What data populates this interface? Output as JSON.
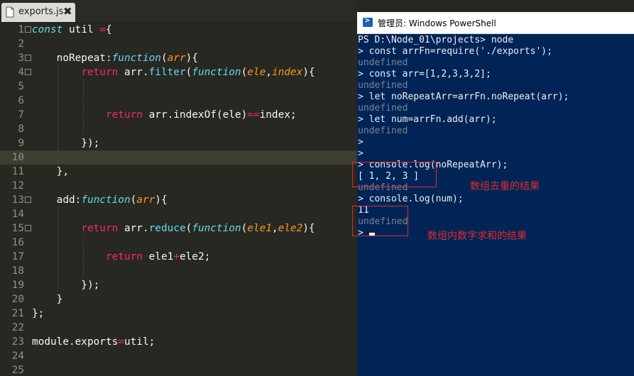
{
  "editor": {
    "tab": {
      "label": "exports.js",
      "close": "✖"
    },
    "lines": [
      {
        "n": "1",
        "fold": true,
        "html": "<span class=\"kw\">const</span> util <span class=\"op\">=</span>{"
      },
      {
        "n": "2",
        "fold": false,
        "html": ""
      },
      {
        "n": "3",
        "fold": true,
        "html": "    noRepeat:<span class=\"kw\">function</span>(<span class=\"arg\">arr</span>){"
      },
      {
        "n": "4",
        "fold": true,
        "html": "        <span class=\"ret\">return</span> arr.<span class=\"fn\">filter</span>(<span class=\"kw\">function</span>(<span class=\"arg\">ele</span>,<span class=\"arg\">index</span>){"
      },
      {
        "n": "5",
        "fold": false,
        "html": ""
      },
      {
        "n": "6",
        "fold": false,
        "html": ""
      },
      {
        "n": "7",
        "fold": false,
        "html": "            <span class=\"ret\">return</span> arr.indexOf(ele)<span class=\"op\">==</span>index;"
      },
      {
        "n": "8",
        "fold": false,
        "html": ""
      },
      {
        "n": "9",
        "fold": false,
        "html": "        });"
      },
      {
        "n": "10",
        "fold": false,
        "html": "",
        "current": true
      },
      {
        "n": "11",
        "fold": false,
        "html": "    },"
      },
      {
        "n": "12",
        "fold": false,
        "html": ""
      },
      {
        "n": "13",
        "fold": true,
        "html": "    add:<span class=\"kw\">function</span>(<span class=\"arg\">arr</span>){"
      },
      {
        "n": "14",
        "fold": false,
        "html": ""
      },
      {
        "n": "15",
        "fold": true,
        "html": "        <span class=\"ret\">return</span> arr.<span class=\"fn\">reduce</span>(<span class=\"kw\">function</span>(<span class=\"arg\">ele1</span>,<span class=\"arg\">ele2</span>){"
      },
      {
        "n": "16",
        "fold": false,
        "html": ""
      },
      {
        "n": "17",
        "fold": false,
        "html": "            <span class=\"ret\">return</span> ele1<span class=\"op\">+</span>ele2;"
      },
      {
        "n": "18",
        "fold": false,
        "html": ""
      },
      {
        "n": "19",
        "fold": false,
        "html": "        });"
      },
      {
        "n": "20",
        "fold": false,
        "html": "    }"
      },
      {
        "n": "21",
        "fold": false,
        "html": "};"
      },
      {
        "n": "22",
        "fold": false,
        "html": ""
      },
      {
        "n": "23",
        "fold": false,
        "html": "module.exports<span class=\"op\">=</span>util;"
      },
      {
        "n": "24",
        "fold": false,
        "html": ""
      },
      {
        "n": "25",
        "fold": false,
        "html": ""
      }
    ]
  },
  "powershell": {
    "title": "管理员: Windows PowerShell",
    "lines": [
      {
        "text": "PS D:\\Node_01\\projects> node",
        "dim": false
      },
      {
        "text": "> const arrFn=require('./exports');",
        "dim": false
      },
      {
        "text": "undefined",
        "dim": true
      },
      {
        "text": "> const arr=[1,2,3,3,2];",
        "dim": false
      },
      {
        "text": "undefined",
        "dim": true
      },
      {
        "text": "> let noRepeatArr=arrFn.noRepeat(arr);",
        "dim": false
      },
      {
        "text": "undefined",
        "dim": true
      },
      {
        "text": "> let num=arrFn.add(arr);",
        "dim": false
      },
      {
        "text": "undefined",
        "dim": true
      },
      {
        "text": ">",
        "dim": false
      },
      {
        "text": ">",
        "dim": false
      },
      {
        "text": "> console.log(noRepeatArr);",
        "dim": false
      },
      {
        "text": "[ 1, 2, 3 ]",
        "dim": false
      },
      {
        "text": "undefined",
        "dim": true
      },
      {
        "text": "> console.log(num);",
        "dim": false
      },
      {
        "text": "11",
        "dim": false
      },
      {
        "text": "undefined",
        "dim": true
      },
      {
        "text": "> ",
        "dim": false,
        "cursor": true
      }
    ],
    "annotations": {
      "dedupe_label": "数组去重的结果",
      "sum_label": "数组内数字求和的结果"
    }
  }
}
